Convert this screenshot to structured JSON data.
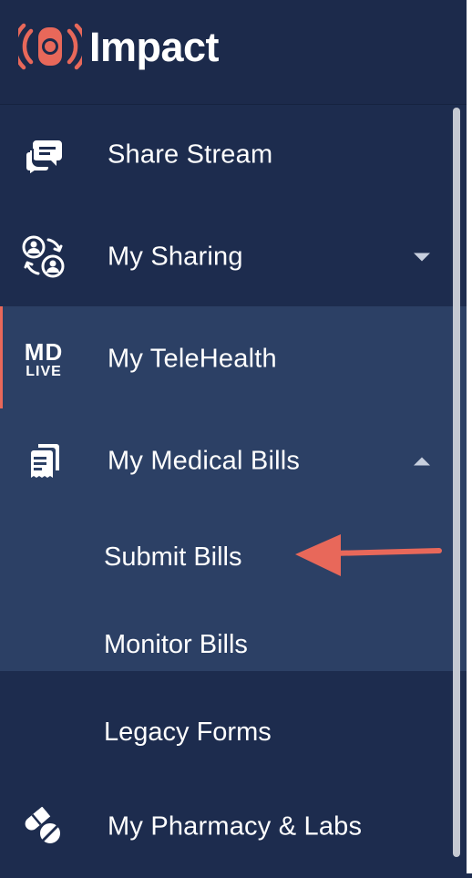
{
  "brand": {
    "name": "Impact",
    "accent": "#e8685a",
    "logo_icon": "broadcast-signal-icon"
  },
  "nav": {
    "items": [
      {
        "label": "Share Stream",
        "icon": "chat-bubbles-icon"
      },
      {
        "label": "My Sharing",
        "icon": "user-exchange-icon",
        "expanded": false
      },
      {
        "label": "My TeleHealth",
        "icon": "mdlive-logo-icon",
        "icon_text_top": "MD",
        "icon_text_bottom": "LIVE"
      },
      {
        "label": "My Medical Bills",
        "icon": "receipts-icon",
        "expanded": true,
        "children": [
          "Submit Bills",
          "Monitor Bills",
          "Legacy Forms"
        ]
      },
      {
        "label": "My Pharmacy & Labs",
        "icon": "pills-icon"
      }
    ]
  },
  "annotation": {
    "type": "arrow",
    "points_to": "Submit Bills",
    "color": "#e8685a"
  },
  "colors": {
    "background": "#1d2c4e",
    "expanded_background": "#2c4065",
    "text": "#ffffff",
    "caret": "#c7cfde"
  }
}
